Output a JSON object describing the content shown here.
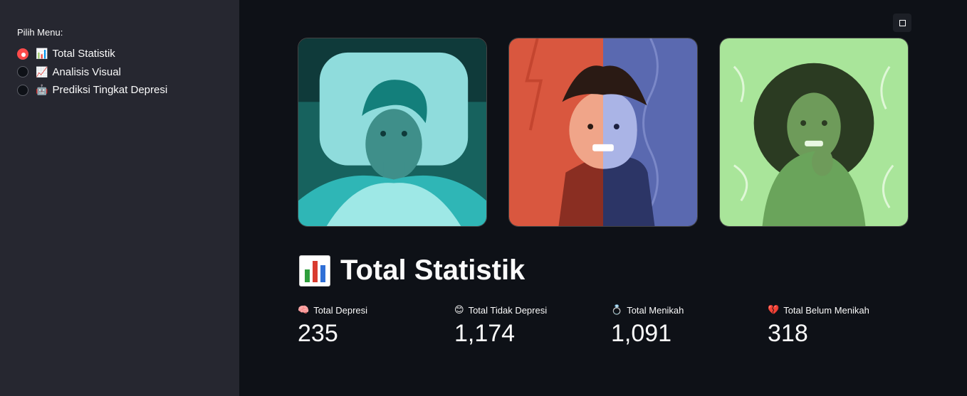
{
  "sidebar": {
    "menu_label": "Pilih Menu:",
    "options": [
      {
        "emoji": "📊",
        "label": "Total Statistik",
        "selected": true
      },
      {
        "emoji": "📈",
        "label": "Analisis Visual",
        "selected": false
      },
      {
        "emoji": "🤖",
        "label": "Prediksi Tingkat Depresi",
        "selected": false
      }
    ]
  },
  "main": {
    "title": "Total Statistik",
    "title_icon": "bar-chart-icon",
    "images": [
      {
        "name": "insomnia-illustration",
        "bg": "#0f3a3a"
      },
      {
        "name": "mood-swing-illustration",
        "bg": "#d9573f"
      },
      {
        "name": "anxiety-illustration",
        "bg": "#a9e59a"
      }
    ],
    "metrics": [
      {
        "emoji": "🧠",
        "label": "Total Depresi",
        "value": "235"
      },
      {
        "emoji": "😊",
        "label": "Total Tidak Depresi",
        "value": "1,174"
      },
      {
        "emoji": "💍",
        "label": "Total Menikah",
        "value": "1,091"
      },
      {
        "emoji": "💔",
        "label": "Total Belum Menikah",
        "value": "318"
      }
    ]
  },
  "colors": {
    "sidebar_bg": "#262730",
    "main_bg": "#0e1117",
    "accent": "#ff4b4b"
  }
}
